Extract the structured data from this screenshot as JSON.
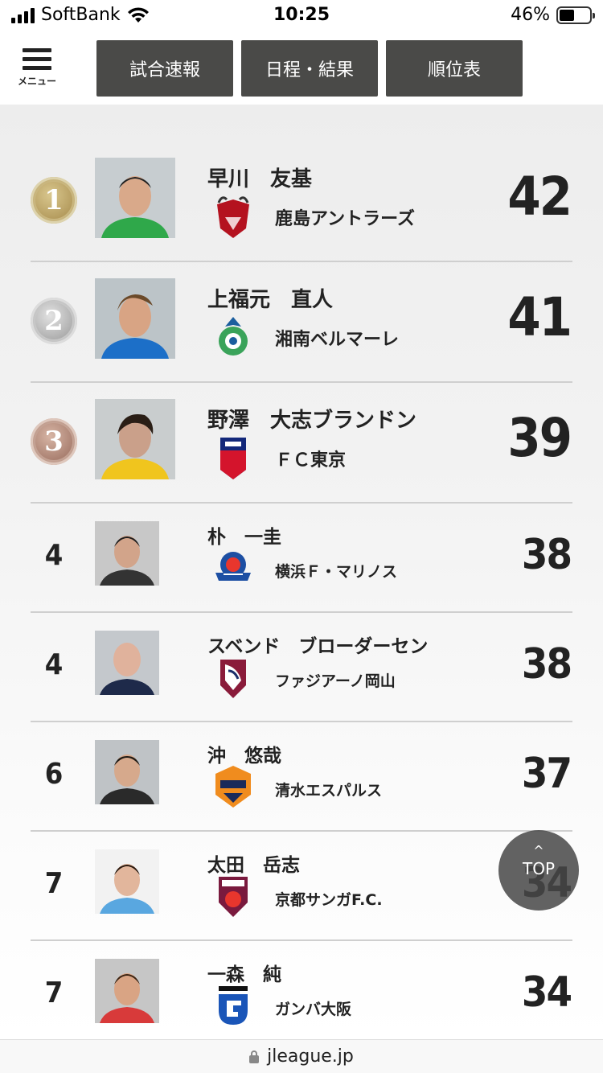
{
  "status_bar": {
    "carrier": "SoftBank",
    "time": "10:25",
    "battery": "46%",
    "battery_level": 0.46
  },
  "header": {
    "menu_label": "メニュー",
    "tabs": [
      {
        "label": "試合速報"
      },
      {
        "label": "日程・結果"
      },
      {
        "label": "順位表"
      }
    ]
  },
  "rankings": [
    {
      "rank": "1",
      "medal": "gold",
      "name": "早川　友基",
      "club": "鹿島アントラーズ",
      "club_logo": "kashima-antlers-logo",
      "goals": "42"
    },
    {
      "rank": "2",
      "medal": "silver",
      "name": "上福元　直人",
      "club": "湘南ベルマーレ",
      "club_logo": "shonan-bellmare-logo",
      "goals": "41"
    },
    {
      "rank": "3",
      "medal": "bronze",
      "name": "野澤　大志ブランドン",
      "club": "ＦＣ東京",
      "club_logo": "fc-tokyo-logo",
      "goals": "39"
    },
    {
      "rank": "4",
      "name": "朴　一圭",
      "club": "横浜Ｆ・マリノス",
      "club_logo": "yokohama-f-marinos-logo",
      "goals": "38"
    },
    {
      "rank": "4",
      "name": "スベンド　ブローダーセン",
      "club": "ファジアーノ岡山",
      "club_logo": "fagiano-okayama-logo",
      "goals": "38"
    },
    {
      "rank": "6",
      "name": "沖　悠哉",
      "club": "清水エスパルス",
      "club_logo": "shimizu-s-pulse-logo",
      "goals": "37"
    },
    {
      "rank": "7",
      "name": "太田　岳志",
      "club": "京都サンガF.C.",
      "club_logo": "kyoto-sanga-logo",
      "goals": "34"
    },
    {
      "rank": "7",
      "name": "一森　純",
      "club": "ガンバ大阪",
      "club_logo": "gamba-osaka-logo",
      "goals": "34"
    }
  ],
  "top_button": {
    "chevron": "^",
    "label": "TOP"
  },
  "url_bar": {
    "url": "jleague.jp"
  }
}
